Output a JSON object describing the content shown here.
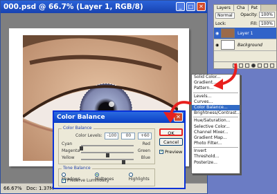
{
  "document": {
    "title": "000.psd @ 66.7% (Layer 1, RGB/8)",
    "status_zoom": "66.67%",
    "status_doc": "Doc: 1.37M"
  },
  "layers_panel": {
    "tabs": [
      "Layers",
      "Cha",
      "Pat"
    ],
    "blend_mode": "Normal",
    "opacity_label": "Opacity:",
    "opacity_value": "100%",
    "lock_label": "Lock:",
    "fill_label": "Fill:",
    "fill_value": "100%",
    "layers": [
      {
        "name": "Layer 1",
        "selected": true
      },
      {
        "name": "Background",
        "selected": false
      }
    ]
  },
  "adjust_menu": {
    "items": [
      "Solid Color...",
      "Gradient...",
      "Pattern...",
      "Levels...",
      "Curves...",
      "Color Balance...",
      "Brightness/Contrast...",
      "Hue/Saturation...",
      "Selective Color...",
      "Channel Mixer...",
      "Gradient Map...",
      "Photo Filter...",
      "Invert",
      "Threshold...",
      "Posterize..."
    ],
    "highlighted_index": 5
  },
  "color_balance": {
    "title": "Color Balance",
    "group_label": "Color Balance",
    "levels_label": "Color Levels:",
    "levels": [
      "-100",
      "00",
      "+60"
    ],
    "sliders": [
      {
        "left": "Cyan",
        "right": "Red",
        "value": -100
      },
      {
        "left": "Magenta",
        "right": "Green",
        "value": 0
      },
      {
        "left": "Yellow",
        "right": "Blue",
        "value": 60
      }
    ],
    "tone_label": "Tone Balance",
    "tones": [
      "Shadows",
      "Midtones",
      "Highlights"
    ],
    "tone_selected": "Midtones",
    "preserve_label": "Preserve Luminosity",
    "preserve_checked": true,
    "ok": "OK",
    "cancel": "Cancel",
    "preview_label": "Preview",
    "preview_checked": true
  },
  "colors": {
    "accent": "#316ac5",
    "arrow": "#e8201e",
    "titlebar": "#1742b0"
  }
}
